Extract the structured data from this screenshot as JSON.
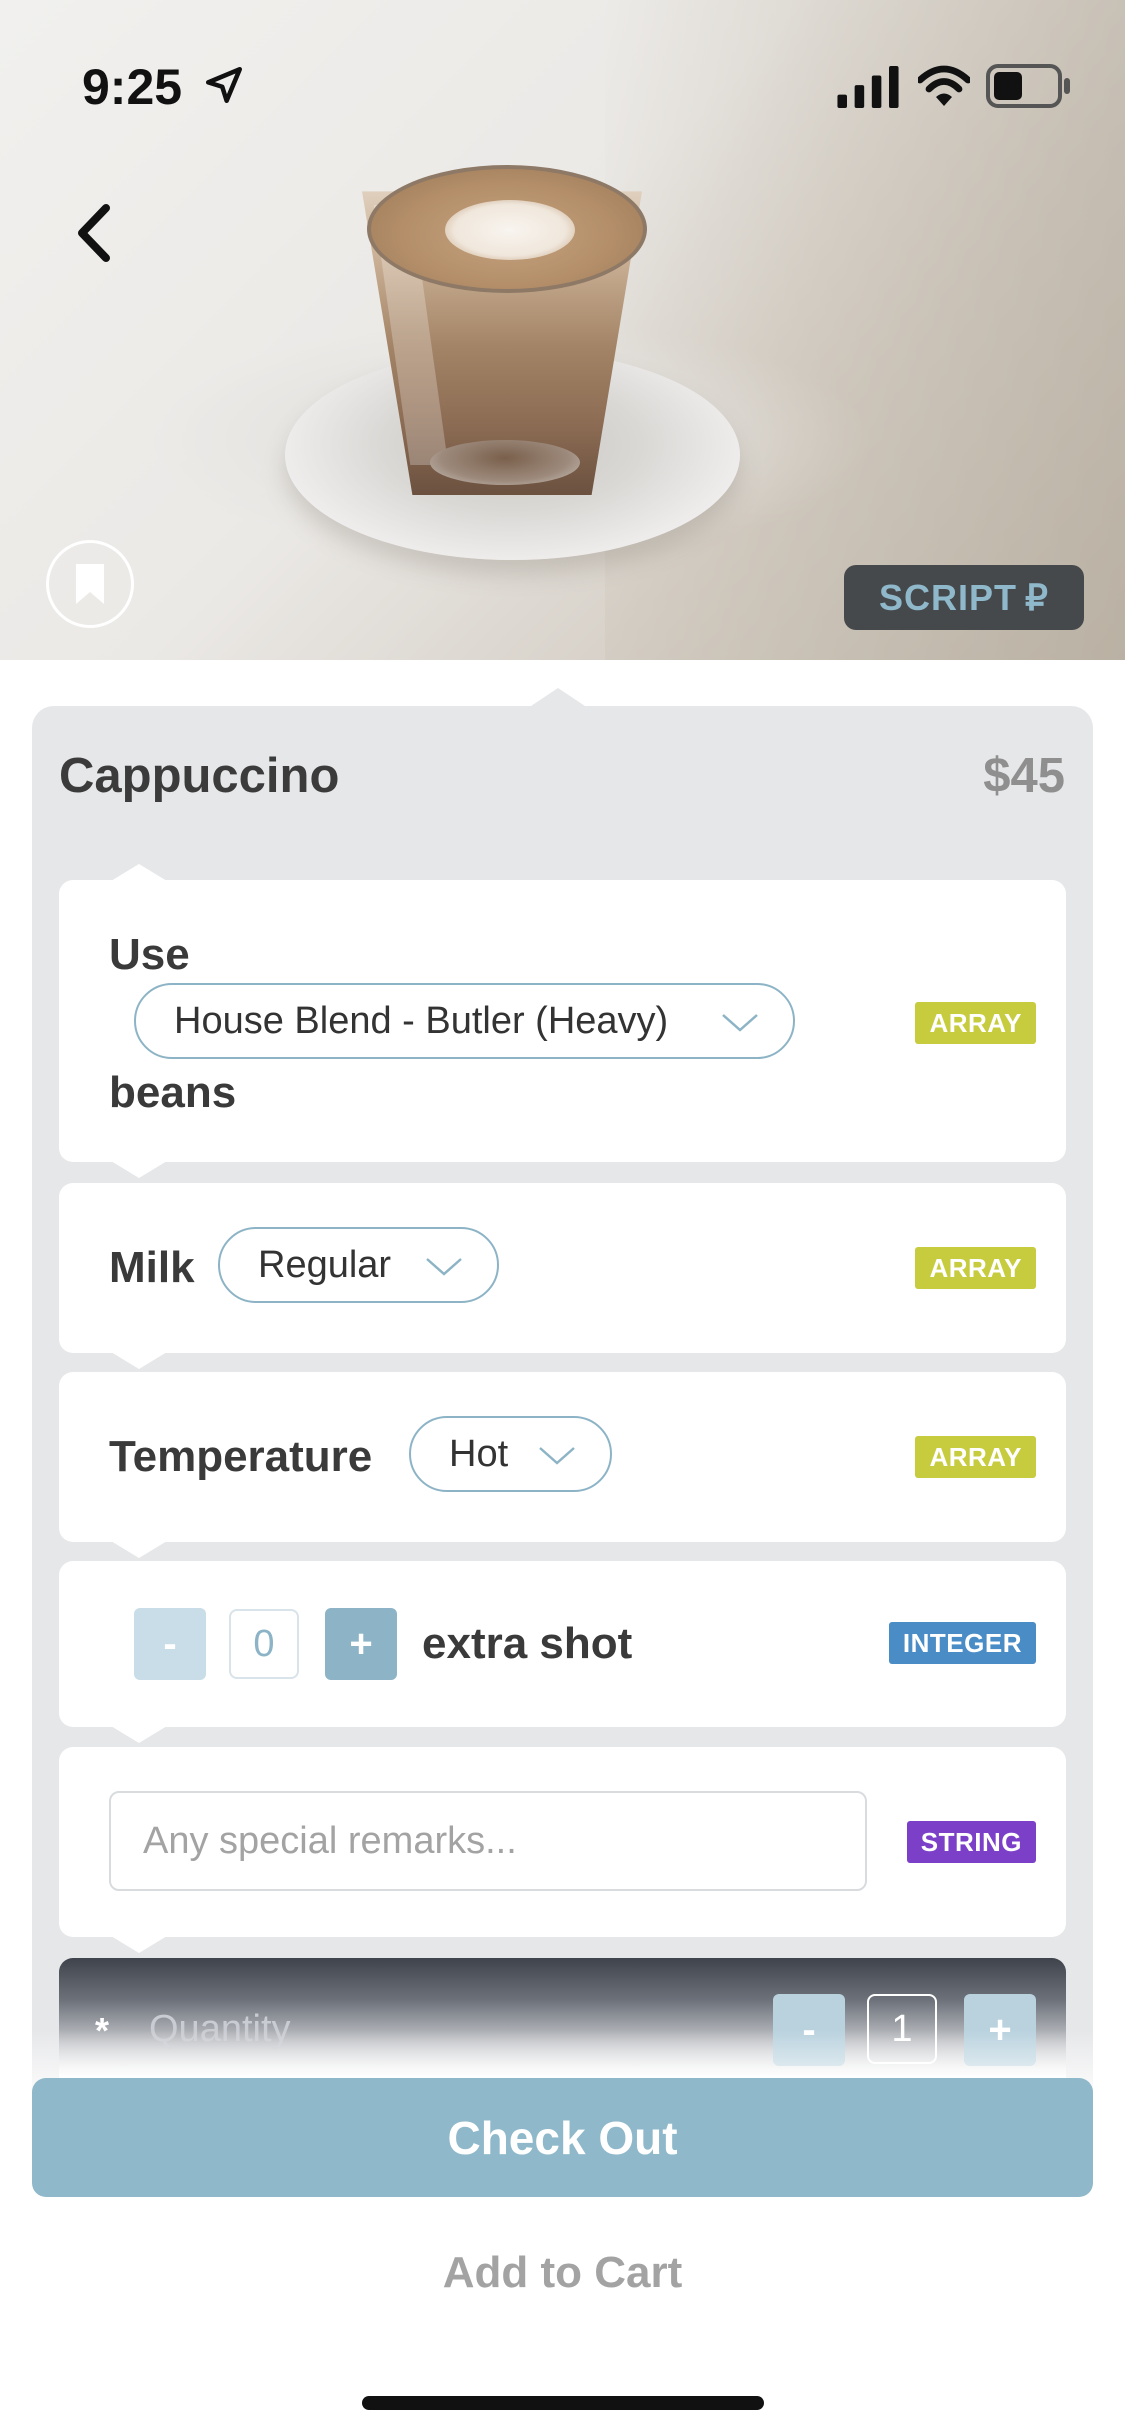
{
  "status_bar": {
    "time": "9:25",
    "icons": [
      "location-arrow-icon",
      "signal-icon",
      "wifi-icon",
      "battery-icon"
    ]
  },
  "hero": {
    "image": "cappuccino-photo",
    "back_icon": "chevron-left-icon",
    "bookmark_icon": "bookmark-icon",
    "brand_badge": "SCRIPT",
    "brand_badge_glyph": "₽"
  },
  "product": {
    "name": "Cappuccino",
    "price": "$45"
  },
  "options": {
    "beans": {
      "prefix": "Use",
      "selected": "House Blend - Butler (Heavy)",
      "suffix": "beans",
      "type": "ARRAY"
    },
    "milk": {
      "label": "Milk",
      "selected": "Regular",
      "type": "ARRAY"
    },
    "temperature": {
      "label": "Temperature",
      "selected": "Hot",
      "type": "ARRAY"
    },
    "extra_shot": {
      "minus": "-",
      "value": "0",
      "plus": "+",
      "label": "extra shot",
      "type": "INTEGER"
    },
    "remarks": {
      "placeholder": "Any special remarks...",
      "type": "STRING"
    }
  },
  "quantity": {
    "required_marker": "*",
    "label": "Quantity",
    "minus": "-",
    "value": "1",
    "plus": "+"
  },
  "actions": {
    "checkout": "Check Out",
    "add_to_cart": "Add to Cart"
  },
  "colors": {
    "accent": "#8fb9cb",
    "array_badge": "#c7cc3f",
    "integer_badge": "#4a8dc6",
    "string_badge": "#7b3fc8",
    "card_bg": "#e6e7e9"
  }
}
